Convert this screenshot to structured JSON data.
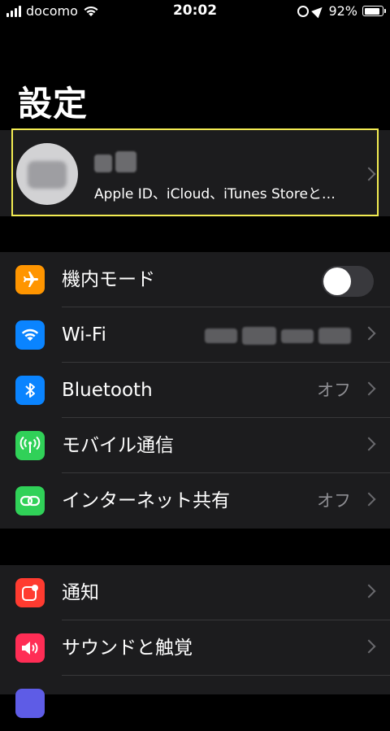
{
  "status_bar": {
    "carrier": "docomo",
    "time": "20:02",
    "battery": "92%",
    "battery_level": 0.92
  },
  "page": {
    "title": "設定"
  },
  "profile": {
    "subtitle": "Apple ID、iCloud、iTunes Storeと…"
  },
  "network_group": [
    {
      "label": "機内モード",
      "icon": "airplane-icon",
      "icon_color": "#ff9500",
      "toggle": false
    },
    {
      "label": "Wi-Fi",
      "icon": "wifi-icon",
      "icon_color": "#0a84ff"
    },
    {
      "label": "Bluetooth",
      "icon": "bluetooth-icon",
      "icon_color": "#0a84ff",
      "value": "オフ"
    },
    {
      "label": "モバイル通信",
      "icon": "cellular-icon",
      "icon_color": "#30d158"
    },
    {
      "label": "インターネット共有",
      "icon": "hotspot-icon",
      "icon_color": "#30d158",
      "value": "オフ"
    }
  ],
  "notifications_group": [
    {
      "label": "通知",
      "icon": "notifications-icon",
      "icon_color": "#ff3b30"
    },
    {
      "label": "サウンドと触覚",
      "icon": "sound-icon",
      "icon_color": "#ff2d55"
    }
  ],
  "colors": {
    "background": "#000000",
    "cell": "#1c1c1e",
    "highlight": "#f3ec52"
  }
}
